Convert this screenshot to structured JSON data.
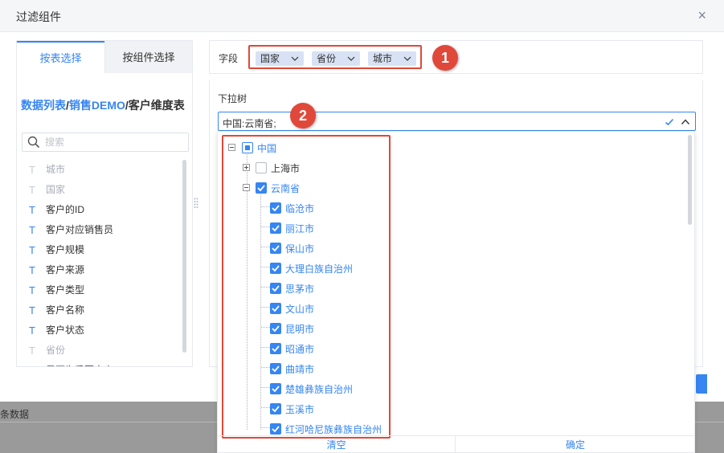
{
  "dialog": {
    "title": "过滤组件",
    "close": "×"
  },
  "left": {
    "tabs": [
      "按表选择",
      "按组件选择"
    ],
    "path": {
      "part1": "数据列表",
      "sep": "/",
      "part2": "销售DEMO",
      "sep2": "/",
      "part3": "客户维度表"
    },
    "search_placeholder": "搜索",
    "field_icon": "T",
    "fields": [
      "城市",
      "国家",
      "客户的ID",
      "客户对应销售员",
      "客户规模",
      "客户来源",
      "客户类型",
      "客户名称",
      "客户状态",
      "省份",
      "是否为重要客户"
    ]
  },
  "field_row": {
    "label": "字段",
    "tags": [
      "国家",
      "省份",
      "城市"
    ]
  },
  "callouts": [
    "1",
    "2"
  ],
  "dropdown": {
    "label": "下拉树",
    "value": "中国:云南省;"
  },
  "tree": {
    "root": "中国",
    "shanghai": "上海市",
    "yunnan": "云南省",
    "cities": [
      "临沧市",
      "丽江市",
      "保山市",
      "大理白族自治州",
      "思茅市",
      "文山市",
      "昆明市",
      "昭通市",
      "曲靖市",
      "楚雄彝族自治州",
      "玉溪市",
      "红河哈尼族彝族自治州"
    ]
  },
  "popup_footer": {
    "clear": "清空",
    "confirm": "确定"
  },
  "background": {
    "text": "条数据"
  },
  "colors": {
    "accent": "#3685f2",
    "highlight": "#e0483a",
    "tag_bg": "#d8e2f4"
  }
}
